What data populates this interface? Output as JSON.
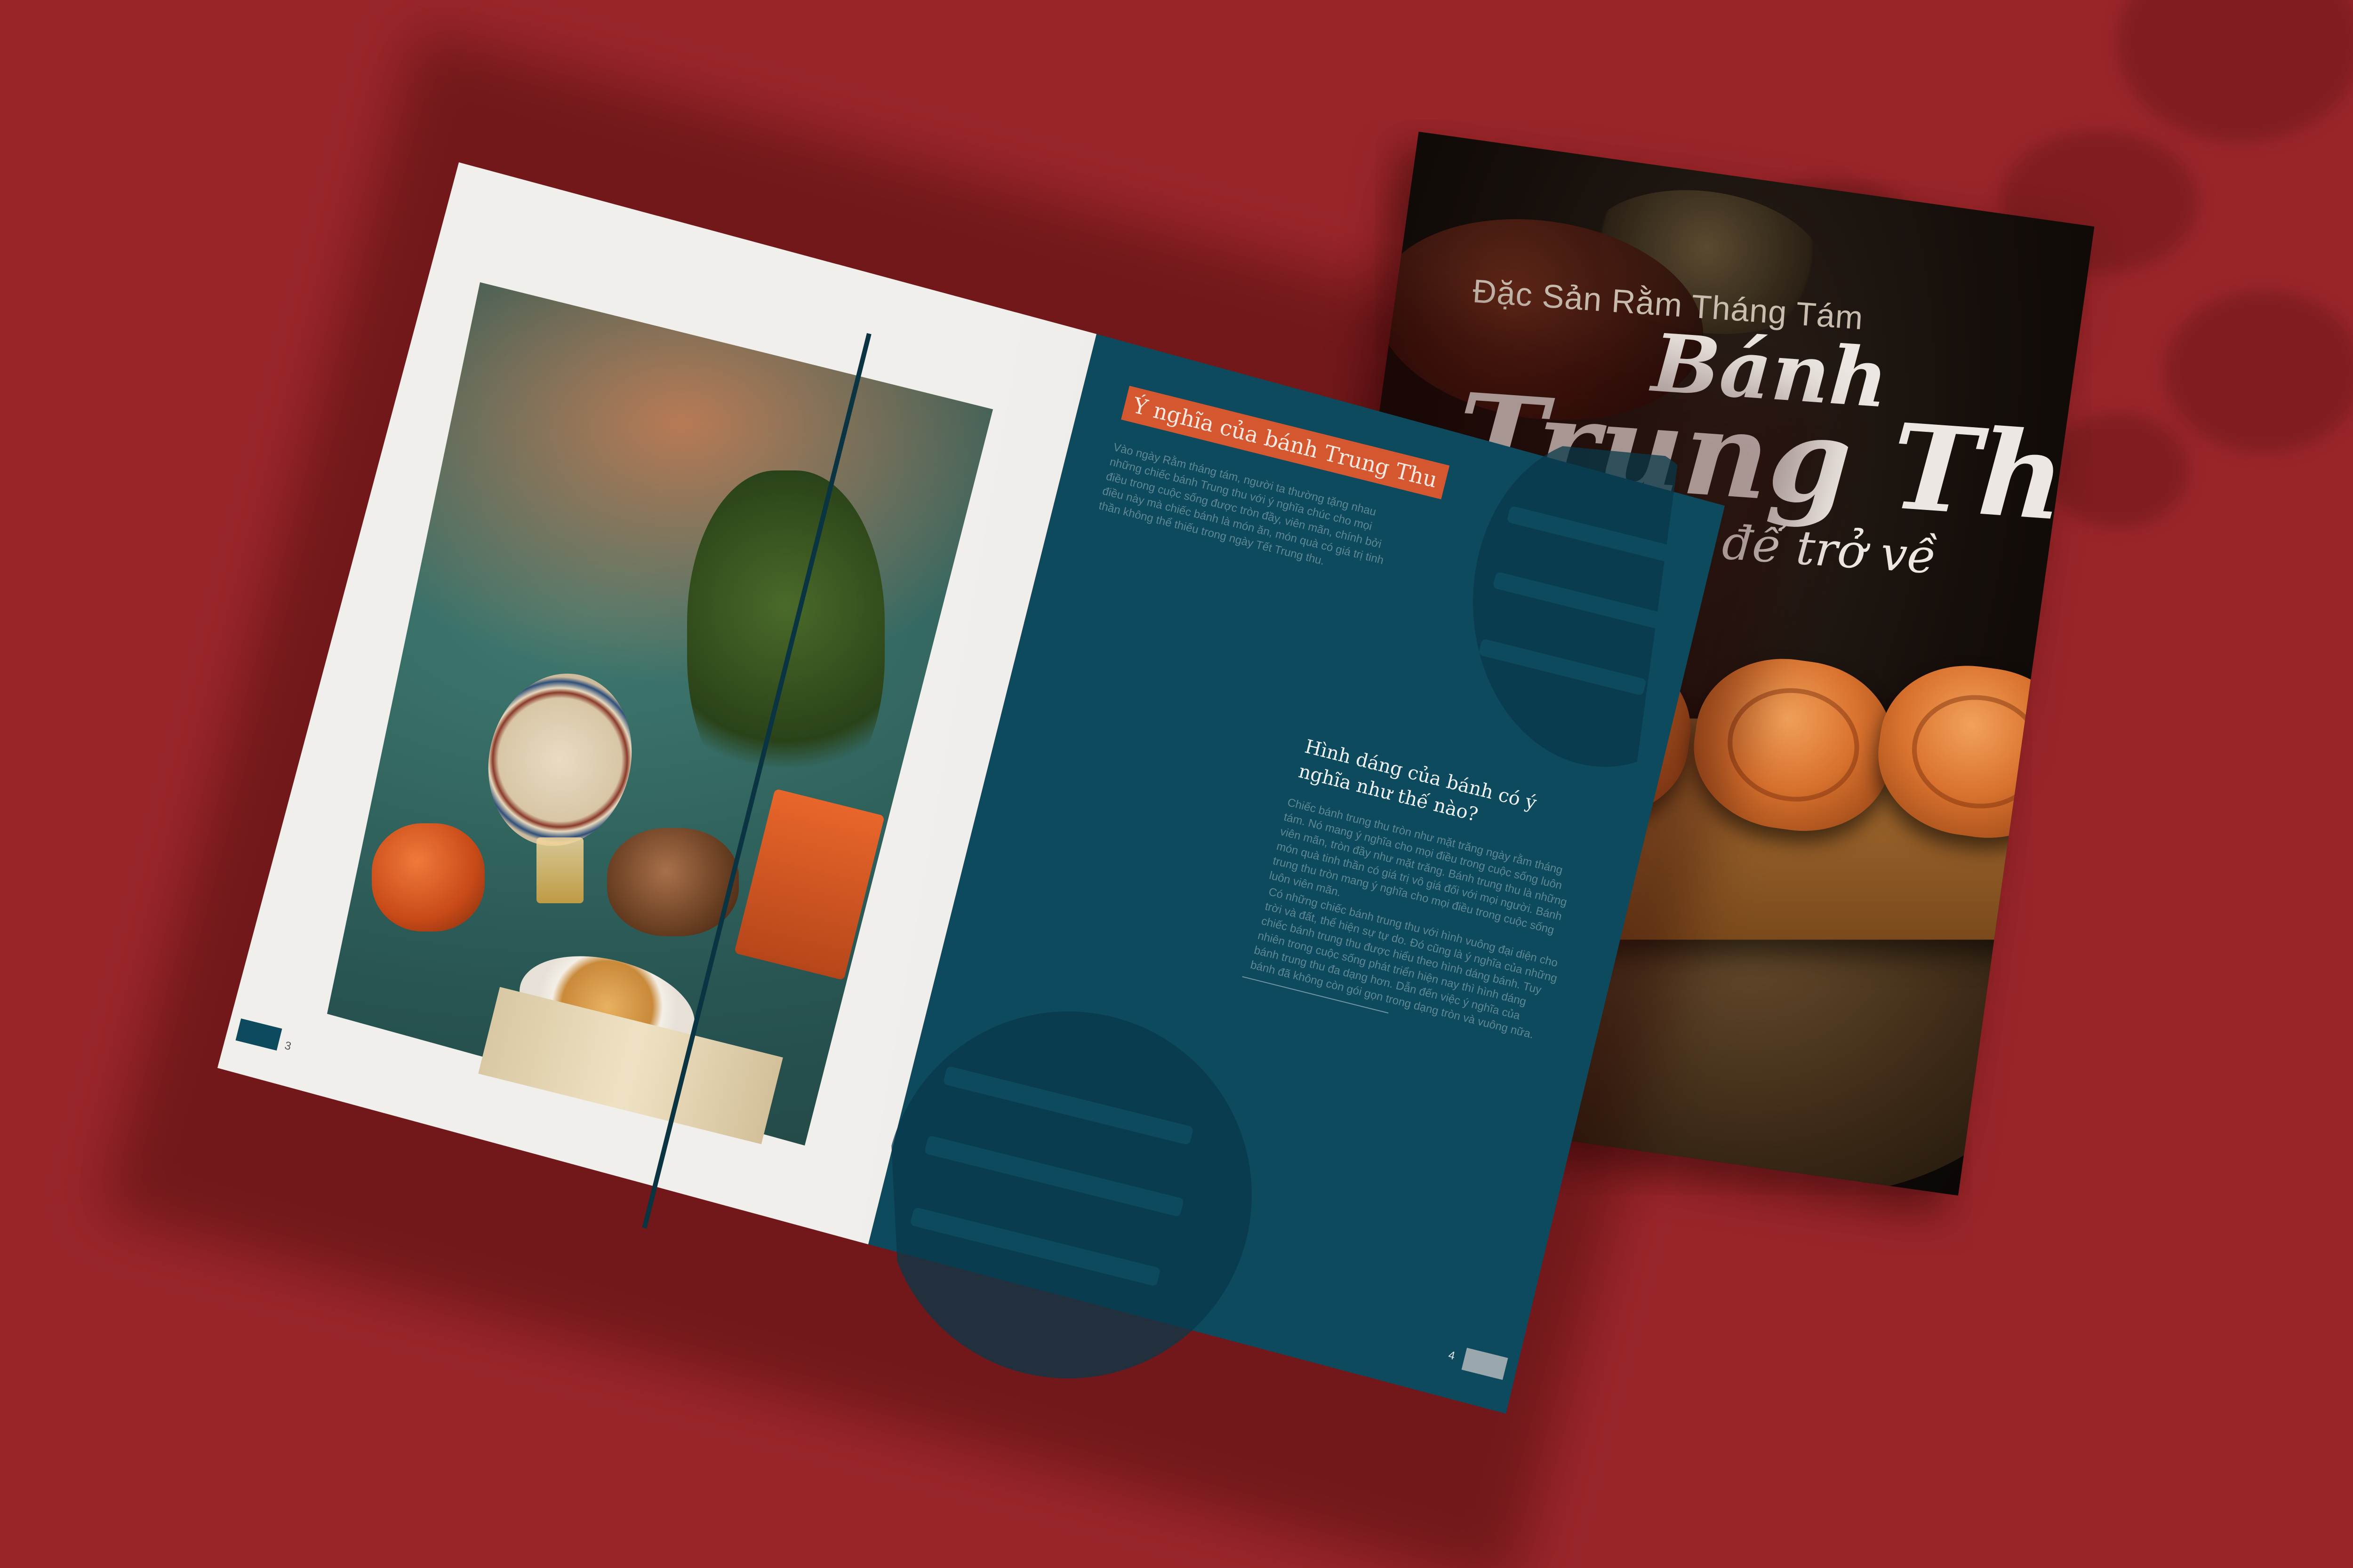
{
  "colors": {
    "background": "#992529",
    "page_teal": "#0d4a5e",
    "tag_orange": "#d4572f",
    "paper": "#f1efec"
  },
  "cover": {
    "subtitle": "Đặc Sản Rằm Tháng Tám",
    "title_line1": "Bánh",
    "title_line2": "Trung Thu",
    "tagline": "để trở về"
  },
  "spread": {
    "left_page_number": "3",
    "right_page_number": "4",
    "section_tag": "Ý nghĩa của bánh Trung Thu",
    "intro_text": "Vào ngày Rằm tháng tám, người ta thường tặng nhau những chiếc bánh Trung thu với ý nghĩa chúc cho mọi điều trong cuộc sống được tròn đầy, viên mãn, chính bởi điều này mà chiếc bánh là món ăn, món quà có giá trị tinh thần không thể thiếu trong ngày Tết Trung thu.",
    "question_heading": "Hình dáng của bánh có ý nghĩa như thế nào?",
    "paragraph_1": "Chiếc bánh trung thu tròn như mặt trăng ngày rằm tháng tám. Nó mang ý nghĩa cho mọi điều trong cuộc sống luôn viên mãn, tròn đầy như mặt trăng. Bánh trung thu là những món quà tinh thần có giá trị vô giá đối với mọi người. Bánh trung thu tròn mang ý nghĩa cho mọi điều trong cuộc sống luôn viên mãn.",
    "paragraph_2": "Có những chiếc bánh trung thu với hình vuông đại diện cho trời và đất, thể hiện sự tự do. Đó cũng là ý nghĩa của những chiếc bánh trung thu được hiểu theo hình dáng bánh. Tuy nhiên trong cuộc sống phát triển hiện nay thì hình dáng bánh trung thu đa dạng hơn. Dẫn đến việc ý nghĩa của bánh đã không còn gói gọn trong dạng tròn và vuông nữa."
  }
}
